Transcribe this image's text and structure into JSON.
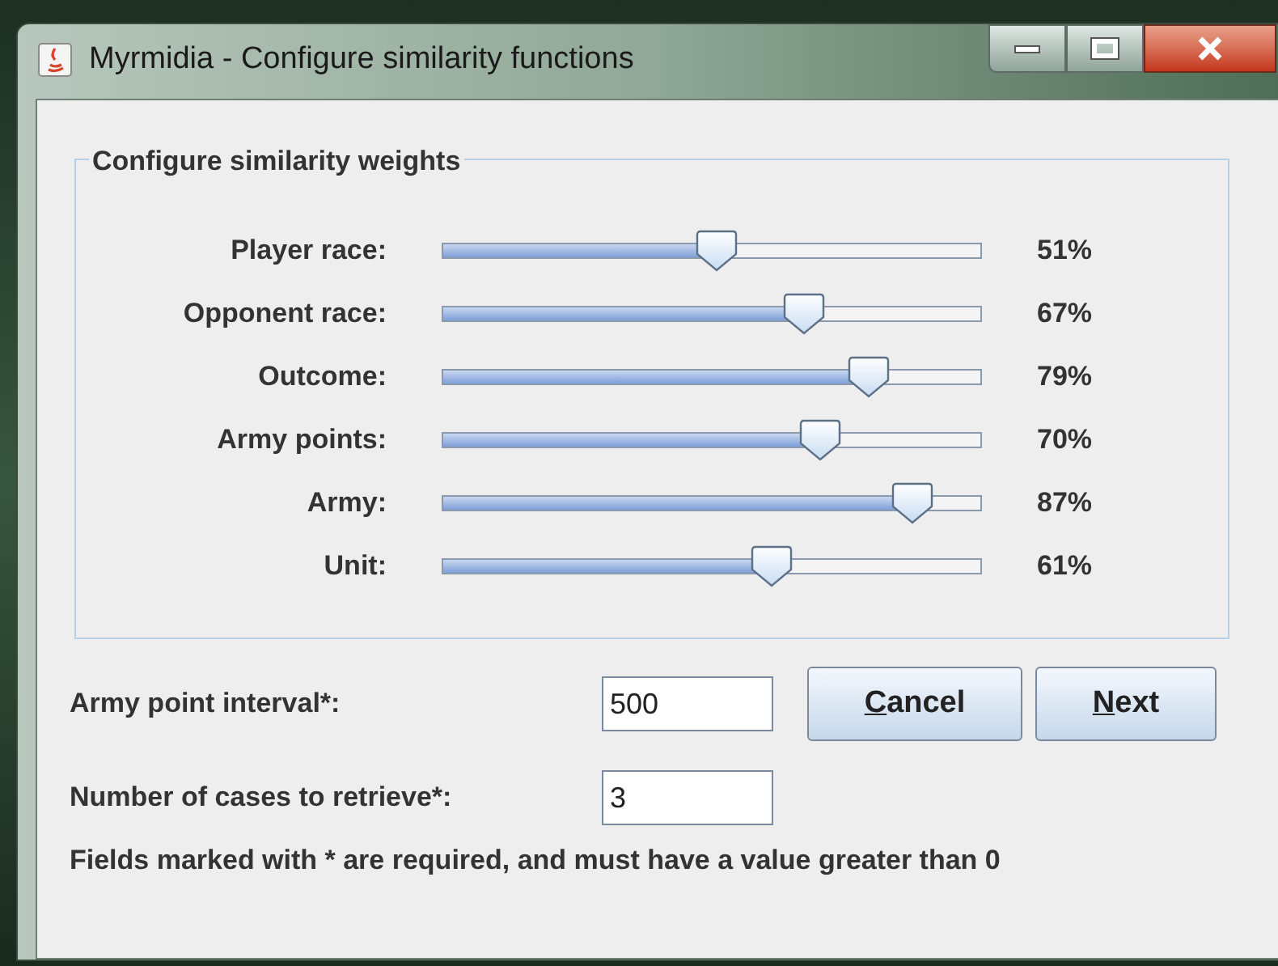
{
  "window": {
    "title": "Myrmidia - Configure similarity functions"
  },
  "group": {
    "title": "Configure similarity weights",
    "sliders": [
      {
        "label": "Player race:",
        "level": 0.51,
        "reading": "51%"
      },
      {
        "label": "Opponent race:",
        "level": 0.67,
        "reading": "67%"
      },
      {
        "label": "Outcome:",
        "level": 0.79,
        "reading": "79%"
      },
      {
        "label": "Army points:",
        "level": 0.7,
        "reading": "70%"
      },
      {
        "label": "Army:",
        "level": 0.87,
        "reading": "87%"
      },
      {
        "label": "Unit:",
        "level": 0.61,
        "reading": "61%"
      }
    ]
  },
  "fields": [
    {
      "label": "Army point interval*:",
      "value": "500"
    },
    {
      "label": "Number of cases to retrieve*:",
      "value": "3"
    }
  ],
  "buttons": [
    {
      "mnemonic": "C",
      "rest": "ancel"
    },
    {
      "mnemonic": "N",
      "rest": "ext"
    }
  ],
  "note": "Fields marked with * are required, and must have a value greater than 0"
}
